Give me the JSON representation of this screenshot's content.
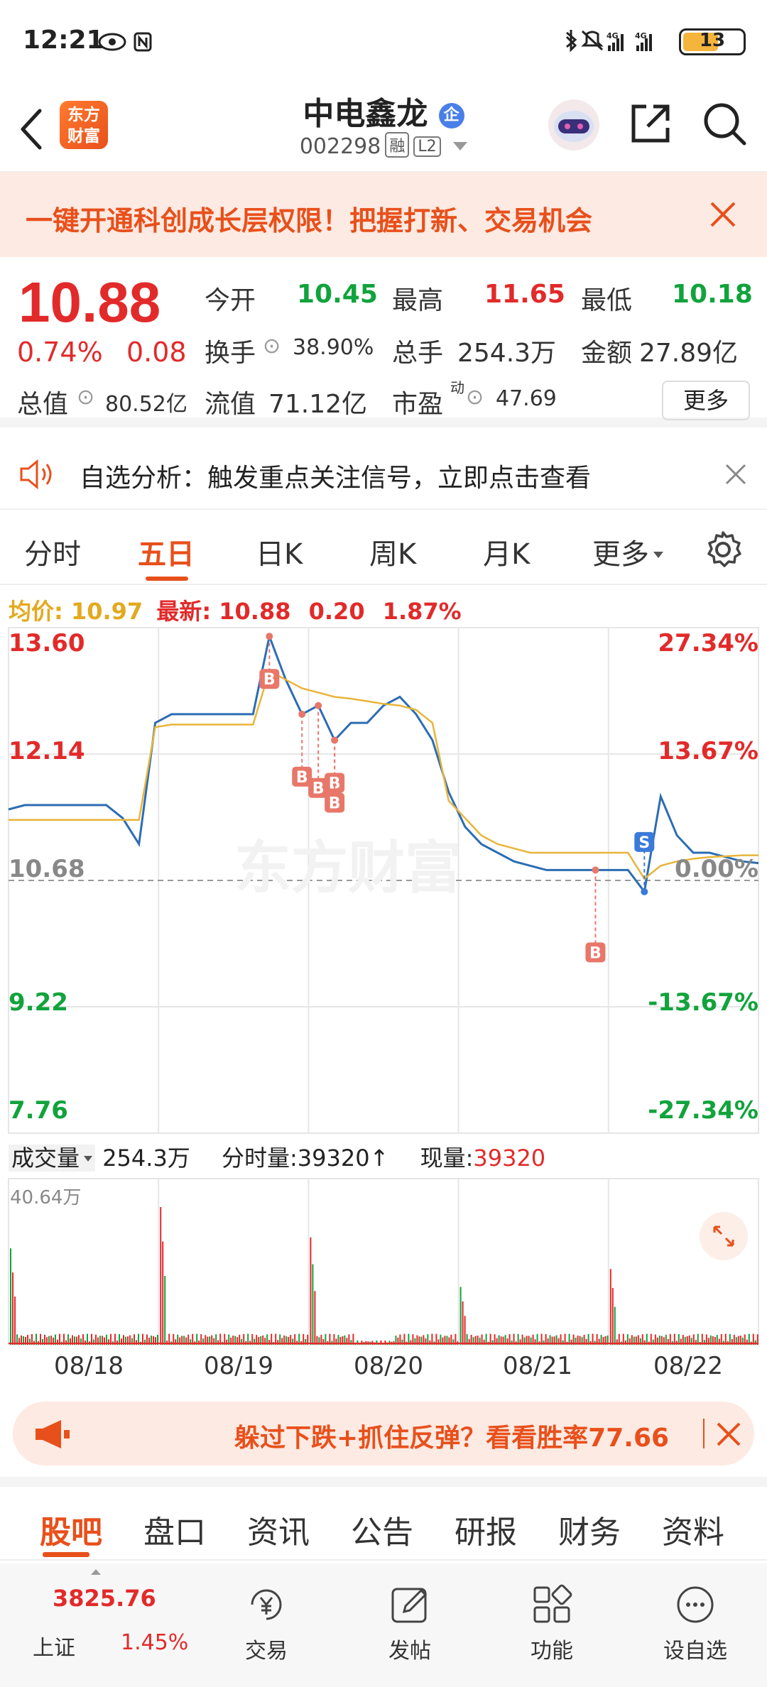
{
  "status": {
    "time": "12:21",
    "battery": "13"
  },
  "header": {
    "logo_text": "东方财富",
    "stock_name": "中电鑫龙",
    "badge": "企",
    "stock_code": "002298",
    "tags": [
      "融",
      "L2"
    ]
  },
  "promo": {
    "text": "一键开通科创成长层权限！把握打新、交易机会"
  },
  "quote": {
    "price": "10.88",
    "change_pct": "0.74%",
    "change": "0.08",
    "open_label": "今开",
    "open": "10.45",
    "high_label": "最高",
    "high": "11.65",
    "low_label": "最低",
    "low": "10.18",
    "turnover_label": "换手",
    "turnover": "38.90%",
    "volume_label": "总手",
    "volume": "254.3万",
    "amount_label": "金额",
    "amount": "27.89亿",
    "total_cap_label": "总值",
    "total_cap": "80.52亿",
    "float_cap_label": "流值",
    "float_cap": "71.12亿",
    "pe_label": "市盈",
    "pe_sup": "动",
    "pe": "47.69",
    "more_label": "更多"
  },
  "signal": {
    "text": "自选分析：触发重点关注信号，立即点击查看"
  },
  "tabs": [
    "分时",
    "五日",
    "日K",
    "周K",
    "月K",
    "更多"
  ],
  "legend": {
    "avg_label": "均价:",
    "avg": "10.97",
    "last_label": "最新:",
    "last": "10.88",
    "chg": "0.20",
    "pct": "1.87%"
  },
  "colors": {
    "up": "#e22a2a",
    "down": "#11a33c",
    "accent": "#e8501b",
    "price_line": "#2c6db3",
    "avg_line": "#e8b53a"
  },
  "chart_data": {
    "type": "line",
    "title": "",
    "x_labels": [
      "08/18",
      "08/19",
      "08/20",
      "08/21",
      "08/22"
    ],
    "y_labels_left": [
      "13.60",
      "12.14",
      "10.68",
      "9.22",
      "7.76"
    ],
    "y_labels_right": [
      "27.34%",
      "13.67%",
      "0.00%",
      "-13.67%",
      "-27.34%"
    ],
    "baseline": 10.68,
    "ylim": [
      7.76,
      13.6
    ],
    "series": [
      {
        "values": [
          11.5,
          11.55,
          11.55,
          11.55,
          11.55,
          11.55,
          11.55,
          11.4,
          11.1,
          12.5,
          12.6,
          12.6,
          12.6,
          12.6,
          12.6,
          12.6,
          13.5,
          13.0,
          12.6,
          12.7,
          12.3,
          12.5,
          12.5,
          12.7,
          12.8,
          12.6,
          12.3,
          11.7,
          11.3,
          11.1,
          11.0,
          10.9,
          10.85,
          10.8,
          10.8,
          10.8,
          10.8,
          10.8,
          10.8,
          10.55,
          11.65,
          11.2,
          11.0,
          11.0,
          10.95,
          10.9,
          10.88
        ]
      },
      {
        "values": [
          11.38,
          11.38,
          11.38,
          11.38,
          11.38,
          11.38,
          11.38,
          11.38,
          11.38,
          12.45,
          12.48,
          12.48,
          12.48,
          12.48,
          12.48,
          12.48,
          13.1,
          13.0,
          12.9,
          12.85,
          12.8,
          12.78,
          12.75,
          12.72,
          12.7,
          12.65,
          12.5,
          11.6,
          11.4,
          11.2,
          11.1,
          11.05,
          11.0,
          11.0,
          11.0,
          11.0,
          11.0,
          11.0,
          11.0,
          10.7,
          10.85,
          10.9,
          10.93,
          10.95,
          10.96,
          10.97,
          10.97
        ]
      }
    ],
    "markers": [
      "B",
      "B",
      "B",
      "B",
      "B",
      "B",
      "S"
    ],
    "volume": {
      "label": "成交量",
      "total": "254.3万",
      "min_label": "分时量",
      "min_value": "39320",
      "now_label": "现量",
      "now_value": "39320",
      "max_label": "40.64万"
    }
  },
  "pill": {
    "text": "躲过下跌+抓住反弹？看看胜率77.66"
  },
  "bottom_tabs": [
    "股吧",
    "盘口",
    "资讯",
    "公告",
    "研报",
    "财务",
    "资料"
  ],
  "bottom_nav": {
    "index_value": "3825.76",
    "index_name": "上证",
    "index_pct": "1.45%",
    "items": [
      "交易",
      "发帖",
      "功能",
      "设自选"
    ]
  }
}
